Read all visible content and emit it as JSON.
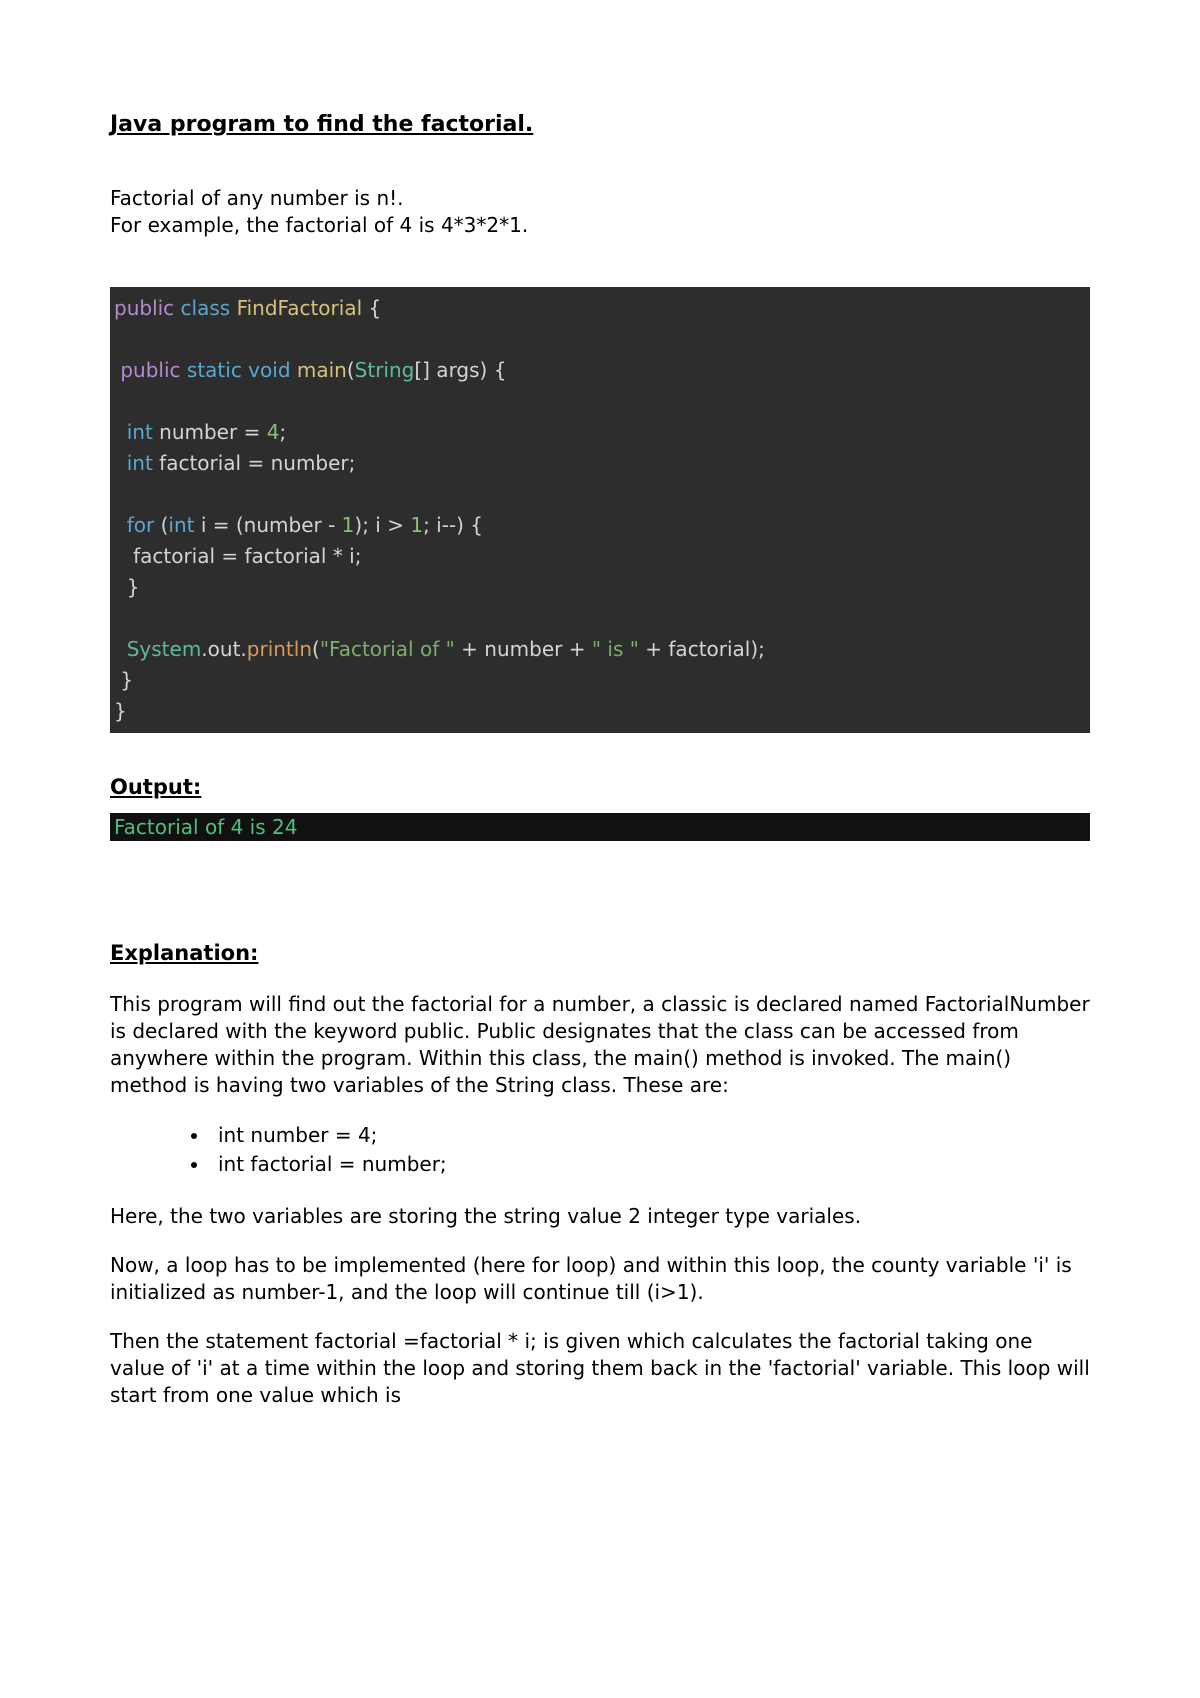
{
  "title": "Java program to find the factorial.",
  "intro_line1": "Factorial of any number is n!.",
  "intro_line2": "For example, the factorial of 4 is 4*3*2*1.",
  "code": {
    "l1_public": "public",
    "l1_class": " class ",
    "l1_name": "FindFactorial",
    "l1_brace": " {",
    "blank": "",
    "l2_public": " public",
    "l2_static": " static",
    "l2_void": " void",
    "l2_main": " main",
    "l2_paren_open": "(",
    "l2_string": "String",
    "l2_args": "[] args) {",
    "l3_int": "  int",
    "l3_rest": " number = ",
    "l3_num": "4",
    "l3_semi": ";",
    "l4_int": "  int",
    "l4_rest": " factorial = number;",
    "l5_for": "  for",
    "l5_rest1": " (",
    "l5_int": "int",
    "l5_rest2": " i = (number - ",
    "l5_num": "1",
    "l5_rest3": "); i > ",
    "l5_num2": "1",
    "l5_rest4": "; i--) {",
    "l6": "   factorial = factorial * i;",
    "l7": "  }",
    "l8_sys": "  System",
    "l8_dot1": ".",
    "l8_out": "out",
    "l8_dot2": ".",
    "l8_println": "println",
    "l8_paren": "(",
    "l8_str1": "\"Factorial of \"",
    "l8_plus1": " + number + ",
    "l8_str2": "\" is \"",
    "l8_plus2": " + factorial);",
    "l9": " }",
    "l10": "}"
  },
  "output_heading": "Output:",
  "output_text": "Factorial of 4 is 24",
  "explain_heading": "Explanation:",
  "para1": "This program will find out the factorial for a number, a classic is declared named FactorialNumber is declared with the keyword public. Public designates that the class can be accessed from anywhere within the program. Within this class, the main() method is invoked. The main() method is having two variables of the String class. These are:",
  "bullet1": "int number = 4;",
  "bullet2": "int factorial = number;",
  "para2": "Here, the two variables are storing the string value 2 integer type variales.",
  "para3": "Now, a loop has to be implemented (here for loop) and within this loop, the county variable 'i' is initialized as number-1, and the loop will continue till (i>1).",
  "para4": "Then the statement factorial =factorial * i; is given which calculates the factorial taking one value of 'i' at a time within the loop and storing them back in the 'factorial' variable. This loop will start from one value which is"
}
